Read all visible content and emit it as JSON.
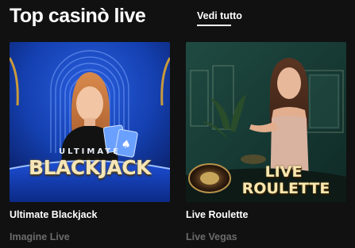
{
  "section": {
    "title": "Top casinò live",
    "see_all_label": "Vedi tutto"
  },
  "games": [
    {
      "name": "Ultimate Blackjack",
      "provider": "Imagine Live",
      "thumbnail_logo_line1": "ULTIMATE",
      "thumbnail_logo_line2": "BLACKJACK",
      "accent_color": "#1f4fc8"
    },
    {
      "name": "Live Roulette",
      "provider": "Live Vegas",
      "thumbnail_logo_line1": "LIVE",
      "thumbnail_logo_line2": "ROULETTE",
      "accent_color": "#1d4a40"
    }
  ],
  "colors": {
    "background": "#111111",
    "text": "#ffffff",
    "provider_text": "#6b6b6b"
  }
}
